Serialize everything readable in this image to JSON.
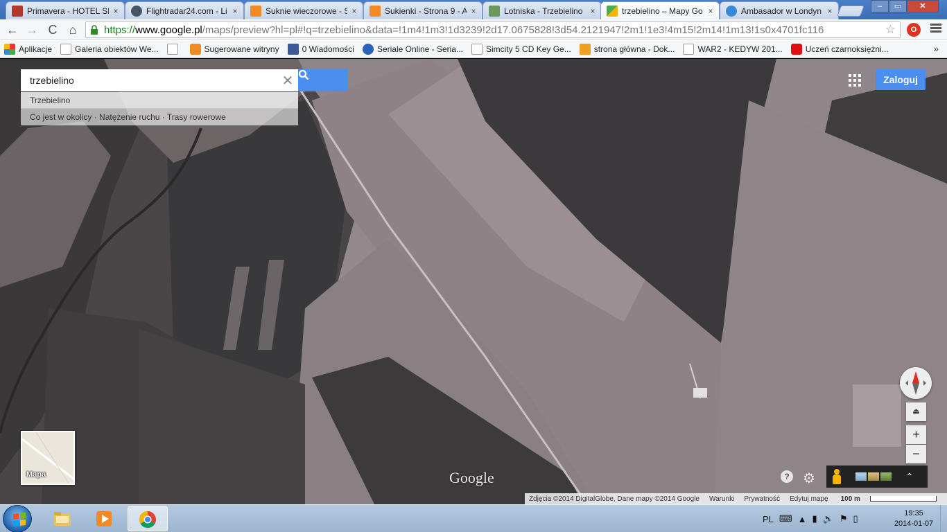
{
  "window": {
    "tabs": [
      {
        "title": "Primavera - HOTEL SP",
        "favicon_color": "#b33a2a"
      },
      {
        "title": "Flightradar24.com - Li",
        "favicon_color": "#445566"
      },
      {
        "title": "Suknie wieczorowe - S",
        "favicon_color": "#f08a24"
      },
      {
        "title": "Sukienki - Strona 9 - A",
        "favicon_color": "#f08a24"
      },
      {
        "title": "Lotniska - Trzebielino",
        "favicon_color": "#6a9a5a"
      },
      {
        "title": "trzebielino – Mapy Go",
        "favicon_color": "#4caf50",
        "active": true
      },
      {
        "title": "Ambasador w Londyn",
        "favicon_color": "#3b8ad9"
      }
    ],
    "close_glyph": "×",
    "controls": {
      "minimize": "–",
      "maximize": "▭",
      "close": "✕"
    }
  },
  "toolbar": {
    "back_icon": "←",
    "forward_icon": "→",
    "reload_icon": "C",
    "home_icon": "⌂",
    "url_scheme": "https://",
    "url_host": "www.google.pl",
    "url_rest": "/maps/preview?hl=pl#!q=trzebielino&data=!1m4!1m3!1d3239!2d17.0675828!3d54.2121947!2m1!1e3!4m15!2m14!1m13!1s0x4701fc116",
    "star_icon": "☆",
    "extension_icon": "O"
  },
  "bookmarks": [
    {
      "label": "Aplikacje",
      "icon": "apps-icon"
    },
    {
      "label": "Galeria obiektów We...",
      "icon": "page-icon"
    },
    {
      "label": "",
      "icon": "page-icon"
    },
    {
      "label": "Sugerowane witryny",
      "icon": "suggested-icon"
    },
    {
      "label": "0 Wiadomości",
      "icon": "facebook-icon"
    },
    {
      "label": "Seriale Online - Seria...",
      "icon": "play-icon"
    },
    {
      "label": "Simcity 5 CD Key Ge...",
      "icon": "page-icon"
    },
    {
      "label": "strona główna - Dok...",
      "icon": "u-icon"
    },
    {
      "label": "WAR2 - KEDYW 201...",
      "icon": "page-icon"
    },
    {
      "label": "Uczeń czarnoksiężni...",
      "icon": "youtube-icon"
    }
  ],
  "bookmarks_more": "»",
  "maps": {
    "search": {
      "value": "trzebielino",
      "placeholder": ""
    },
    "clear_icon": "✕",
    "suggestions": {
      "title": "Trzebielino",
      "links": "Co jest w okolicy · Natężenie ruchu · Trasy rowerowe"
    },
    "sign_in_label": "Zaloguj",
    "help_label": "?",
    "settings_icon": "⚙",
    "tray_expand": "⌃",
    "tilt_icon": "⏏",
    "zoom_in": "+",
    "zoom_out": "−",
    "map_type_label": "Mapa",
    "logo": "Google",
    "footer": {
      "imagery": "Zdjęcia ©2014 DigitalGlobe, Dane mapy ©2014 Google",
      "terms": "Warunki",
      "privacy": "Prywatność",
      "edit": "Edytuj mapę",
      "scale": "100 m"
    },
    "colors": {
      "accent": "#4c8ef0"
    }
  },
  "taskbar": {
    "language": "PL",
    "time": "19:35",
    "date": "2014-01-07"
  }
}
